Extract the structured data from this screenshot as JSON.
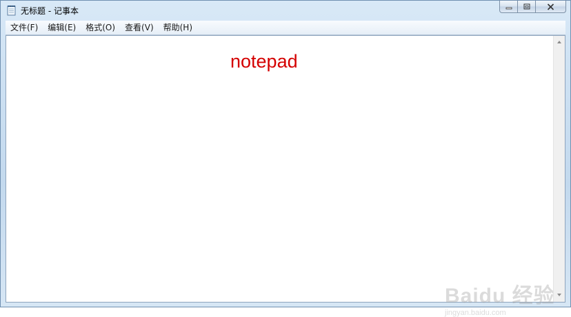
{
  "window": {
    "title": "无标题 - 记事本",
    "caption_buttons": [
      "minimize",
      "maximize",
      "close"
    ]
  },
  "menubar": {
    "items": [
      {
        "label": "文件(F)"
      },
      {
        "label": "编辑(E)"
      },
      {
        "label": "格式(O)"
      },
      {
        "label": "查看(V)"
      },
      {
        "label": "帮助(H)"
      }
    ]
  },
  "editor": {
    "content": "notepad",
    "text_color": "#d40000"
  },
  "watermark": {
    "logo": "Baidu 经验",
    "url": "jingyan.baidu.com"
  },
  "icons": {
    "app": "notepad-icon",
    "minimize": "minimize-icon",
    "maximize": "maximize-icon",
    "close": "close-icon"
  }
}
